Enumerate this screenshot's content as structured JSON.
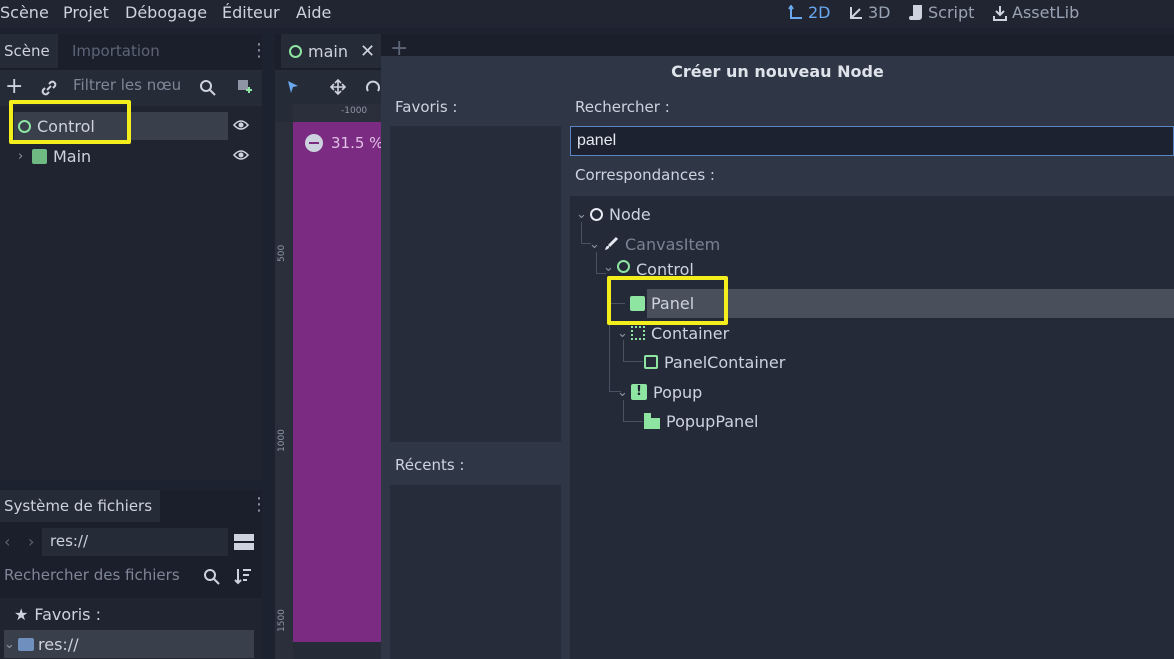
{
  "menu": [
    "Scène",
    "Projet",
    "Débogage",
    "Éditeur",
    "Aide"
  ],
  "main_screens": [
    {
      "label": "2D",
      "icon": "2d-icon"
    },
    {
      "label": "3D",
      "icon": "3d-icon"
    },
    {
      "label": "Script",
      "icon": "script-icon"
    },
    {
      "label": "AssetLib",
      "icon": "assetlib-icon"
    }
  ],
  "scene_dock": {
    "tabs": [
      "Scène",
      "Importation"
    ],
    "filter_placeholder": "Filtrer les nœu",
    "nodes": [
      {
        "label": "Control",
        "icon": "control-icon",
        "selected": true,
        "highlighted": true
      },
      {
        "label": "Main",
        "icon": "panel-icon"
      }
    ]
  },
  "filesystem_dock": {
    "title": "Système de fichiers",
    "path": "res://",
    "search_placeholder": "Rechercher des fichiers",
    "items": [
      {
        "label": "Favoris :",
        "icon": "star-icon"
      },
      {
        "label": "res://",
        "icon": "folder-icon",
        "selected": true
      }
    ]
  },
  "editor": {
    "tab": "main",
    "zoom": "31.5 %",
    "ruler_marks": [
      "-1000",
      "500",
      "1000",
      "1500"
    ]
  },
  "dialog": {
    "title": "Créer un nouveau Node",
    "favorites_label": "Favoris :",
    "recent_label": "Récents :",
    "search_label": "Rechercher :",
    "search_value": "panel",
    "matches_label": "Correspondances :",
    "matches": [
      {
        "label": "Node",
        "icon": "node-icon",
        "depth": 0,
        "disabled": false
      },
      {
        "label": "CanvasItem",
        "icon": "canvasitem-icon",
        "depth": 1,
        "disabled": true
      },
      {
        "label": "Control",
        "icon": "control-icon",
        "depth": 2,
        "disabled": false
      },
      {
        "label": "Panel",
        "icon": "panel-icon",
        "depth": 3,
        "selected": true,
        "highlighted": true
      },
      {
        "label": "Container",
        "icon": "container-icon",
        "depth": 3
      },
      {
        "label": "PanelContainer",
        "icon": "panelcontainer-icon",
        "depth": 4
      },
      {
        "label": "Popup",
        "icon": "popup-icon",
        "depth": 3
      },
      {
        "label": "PopupPanel",
        "icon": "popuppanel-icon",
        "depth": 4
      }
    ]
  },
  "colors": {
    "highlight": "#f5ee1d",
    "accent": "#6aa8ef",
    "node_green": "#8ee4a1",
    "viewport_purple": "#7b2b82"
  }
}
